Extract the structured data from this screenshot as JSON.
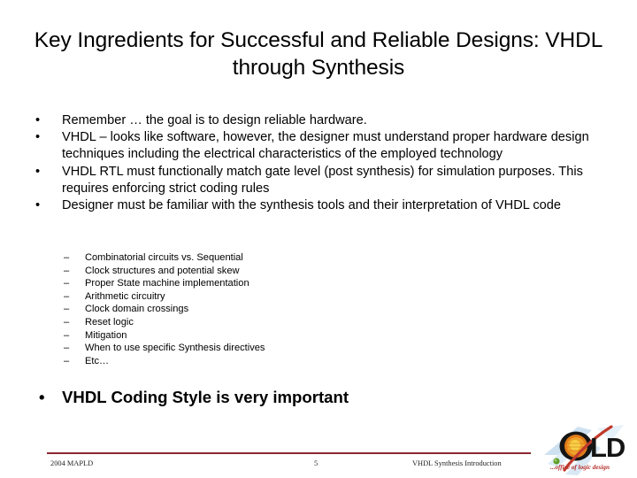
{
  "slide": {
    "title": "Key Ingredients for Successful and Reliable Designs: VHDL through Synthesis",
    "bullet_marker": "•",
    "sub_marker": "–",
    "bullets": [
      {
        "text": "Remember … the goal is to design reliable hardware."
      },
      {
        "text": "VHDL – looks like software, however, the designer must understand proper hardware design techniques including the electrical characteristics of the employed technology"
      },
      {
        "text": "VHDL RTL must functionally match gate level (post synthesis) for simulation purposes.  This requires enforcing strict coding rules"
      },
      {
        "text": "Designer must be familiar with the synthesis tools and their interpretation of VHDL code"
      }
    ],
    "sub_bullets": [
      {
        "text": "Combinatorial circuits vs. Sequential"
      },
      {
        "text": "Clock structures and potential skew"
      },
      {
        "text": "Proper State machine implementation"
      },
      {
        "text": "Arithmetic circuitry"
      },
      {
        "text": "Clock domain crossings"
      },
      {
        "text": "Reset logic"
      },
      {
        "text": "Mitigation"
      },
      {
        "text": "When to use specific Synthesis directives"
      },
      {
        "text": "Etc…"
      }
    ],
    "emphasis": {
      "marker": "•",
      "text": "VHDL Coding Style is very important"
    }
  },
  "footer": {
    "left": "2004 MAPLD",
    "page_number": "5",
    "right": "VHDL Synthesis Introduction",
    "rule_color": "#8B2832"
  },
  "logo": {
    "letters": "LD",
    "tagline": "...office of logic design",
    "colors": {
      "sun": "#E8821E",
      "sun_inner": "#F5C542",
      "ring": "#1a1a1a",
      "swoosh": "#C0392B",
      "wing": "#BBD9EE",
      "letters": "#1a1a1a",
      "tagline": "#C0392B",
      "dot": "#5B9B2E"
    }
  }
}
